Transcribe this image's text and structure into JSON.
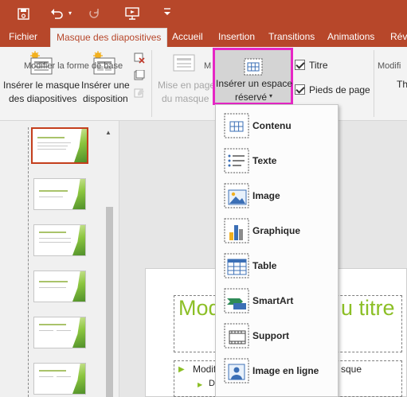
{
  "titlebar": {
    "icons": [
      "save-icon",
      "undo-icon",
      "undo-dropdown-icon",
      "redo-icon",
      "present-icon",
      "customize-quick-access-icon"
    ]
  },
  "tabs": [
    {
      "label": "Fichier"
    },
    {
      "label": "Masque des diapositives"
    },
    {
      "label": "Accueil"
    },
    {
      "label": "Insertion"
    },
    {
      "label": "Transitions"
    },
    {
      "label": "Animations"
    },
    {
      "label": "Rév"
    }
  ],
  "ribbon": {
    "insert_master": {
      "line1": "Insérer le masque",
      "line2": "des diapositives"
    },
    "insert_layout": {
      "line1": "Insérer une",
      "line2": "disposition"
    },
    "master_layout": {
      "line1": "Mise en page",
      "line2": "du masque"
    },
    "insert_placeholder": {
      "line1": "Insérer un espace",
      "line2": "réservé"
    },
    "title_check": {
      "label": "Titre",
      "checked": true
    },
    "footer_check": {
      "label": "Pieds de page",
      "checked": true
    },
    "themes_partial": "Th",
    "group_edit_master": "Modifier la forme de base",
    "group_master_layout_partial": "M",
    "group_edit_theme_partial": "Modifi"
  },
  "menu": {
    "items": [
      {
        "label": "Contenu",
        "icon": "content-placeholder-icon"
      },
      {
        "label": "Texte",
        "icon": "text-placeholder-icon"
      },
      {
        "label": "Image",
        "icon": "picture-placeholder-icon"
      },
      {
        "label": "Graphique",
        "icon": "chart-placeholder-icon"
      },
      {
        "label": "Table",
        "icon": "table-placeholder-icon"
      },
      {
        "label": "SmartArt",
        "icon": "smartart-placeholder-icon"
      },
      {
        "label": "Support",
        "icon": "media-placeholder-icon"
      },
      {
        "label": "Image en ligne",
        "icon": "online-picture-placeholder-icon"
      }
    ]
  },
  "slide": {
    "title_left": "Modi",
    "title_right": "u titre",
    "body_line1_left": "Modif",
    "body_line1_right": "sque",
    "body_line2_left": "De"
  },
  "colors": {
    "accent": "#b7472a",
    "highlight": "#e626c5",
    "slide_green": "#8cbf26"
  }
}
